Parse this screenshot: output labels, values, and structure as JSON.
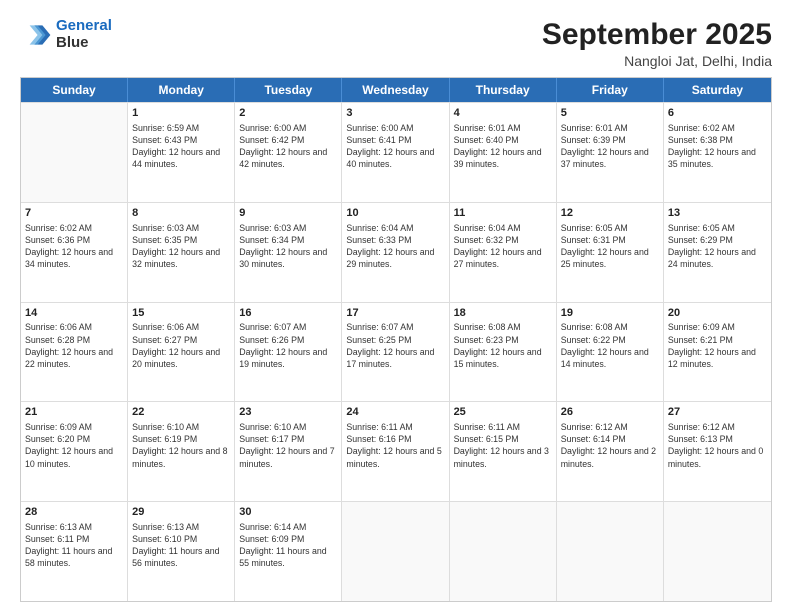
{
  "header": {
    "logo_line1": "General",
    "logo_line2": "Blue",
    "main_title": "September 2025",
    "subtitle": "Nangloi Jat, Delhi, India"
  },
  "calendar": {
    "days_of_week": [
      "Sunday",
      "Monday",
      "Tuesday",
      "Wednesday",
      "Thursday",
      "Friday",
      "Saturday"
    ],
    "rows": [
      [
        {
          "day": "",
          "empty": true
        },
        {
          "day": "1",
          "sunrise": "6:59 AM",
          "sunset": "6:43 PM",
          "daylight": "12 hours and 44 minutes."
        },
        {
          "day": "2",
          "sunrise": "6:00 AM",
          "sunset": "6:42 PM",
          "daylight": "12 hours and 42 minutes."
        },
        {
          "day": "3",
          "sunrise": "6:00 AM",
          "sunset": "6:41 PM",
          "daylight": "12 hours and 40 minutes."
        },
        {
          "day": "4",
          "sunrise": "6:01 AM",
          "sunset": "6:40 PM",
          "daylight": "12 hours and 39 minutes."
        },
        {
          "day": "5",
          "sunrise": "6:01 AM",
          "sunset": "6:39 PM",
          "daylight": "12 hours and 37 minutes."
        },
        {
          "day": "6",
          "sunrise": "6:02 AM",
          "sunset": "6:38 PM",
          "daylight": "12 hours and 35 minutes."
        }
      ],
      [
        {
          "day": "7",
          "sunrise": "6:02 AM",
          "sunset": "6:36 PM",
          "daylight": "12 hours and 34 minutes."
        },
        {
          "day": "8",
          "sunrise": "6:03 AM",
          "sunset": "6:35 PM",
          "daylight": "12 hours and 32 minutes."
        },
        {
          "day": "9",
          "sunrise": "6:03 AM",
          "sunset": "6:34 PM",
          "daylight": "12 hours and 30 minutes."
        },
        {
          "day": "10",
          "sunrise": "6:04 AM",
          "sunset": "6:33 PM",
          "daylight": "12 hours and 29 minutes."
        },
        {
          "day": "11",
          "sunrise": "6:04 AM",
          "sunset": "6:32 PM",
          "daylight": "12 hours and 27 minutes."
        },
        {
          "day": "12",
          "sunrise": "6:05 AM",
          "sunset": "6:31 PM",
          "daylight": "12 hours and 25 minutes."
        },
        {
          "day": "13",
          "sunrise": "6:05 AM",
          "sunset": "6:29 PM",
          "daylight": "12 hours and 24 minutes."
        }
      ],
      [
        {
          "day": "14",
          "sunrise": "6:06 AM",
          "sunset": "6:28 PM",
          "daylight": "12 hours and 22 minutes."
        },
        {
          "day": "15",
          "sunrise": "6:06 AM",
          "sunset": "6:27 PM",
          "daylight": "12 hours and 20 minutes."
        },
        {
          "day": "16",
          "sunrise": "6:07 AM",
          "sunset": "6:26 PM",
          "daylight": "12 hours and 19 minutes."
        },
        {
          "day": "17",
          "sunrise": "6:07 AM",
          "sunset": "6:25 PM",
          "daylight": "12 hours and 17 minutes."
        },
        {
          "day": "18",
          "sunrise": "6:08 AM",
          "sunset": "6:23 PM",
          "daylight": "12 hours and 15 minutes."
        },
        {
          "day": "19",
          "sunrise": "6:08 AM",
          "sunset": "6:22 PM",
          "daylight": "12 hours and 14 minutes."
        },
        {
          "day": "20",
          "sunrise": "6:09 AM",
          "sunset": "6:21 PM",
          "daylight": "12 hours and 12 minutes."
        }
      ],
      [
        {
          "day": "21",
          "sunrise": "6:09 AM",
          "sunset": "6:20 PM",
          "daylight": "12 hours and 10 minutes."
        },
        {
          "day": "22",
          "sunrise": "6:10 AM",
          "sunset": "6:19 PM",
          "daylight": "12 hours and 8 minutes."
        },
        {
          "day": "23",
          "sunrise": "6:10 AM",
          "sunset": "6:17 PM",
          "daylight": "12 hours and 7 minutes."
        },
        {
          "day": "24",
          "sunrise": "6:11 AM",
          "sunset": "6:16 PM",
          "daylight": "12 hours and 5 minutes."
        },
        {
          "day": "25",
          "sunrise": "6:11 AM",
          "sunset": "6:15 PM",
          "daylight": "12 hours and 3 minutes."
        },
        {
          "day": "26",
          "sunrise": "6:12 AM",
          "sunset": "6:14 PM",
          "daylight": "12 hours and 2 minutes."
        },
        {
          "day": "27",
          "sunrise": "6:12 AM",
          "sunset": "6:13 PM",
          "daylight": "12 hours and 0 minutes."
        }
      ],
      [
        {
          "day": "28",
          "sunrise": "6:13 AM",
          "sunset": "6:11 PM",
          "daylight": "11 hours and 58 minutes."
        },
        {
          "day": "29",
          "sunrise": "6:13 AM",
          "sunset": "6:10 PM",
          "daylight": "11 hours and 56 minutes."
        },
        {
          "day": "30",
          "sunrise": "6:14 AM",
          "sunset": "6:09 PM",
          "daylight": "11 hours and 55 minutes."
        },
        {
          "day": "",
          "empty": true
        },
        {
          "day": "",
          "empty": true
        },
        {
          "day": "",
          "empty": true
        },
        {
          "day": "",
          "empty": true
        }
      ]
    ]
  }
}
